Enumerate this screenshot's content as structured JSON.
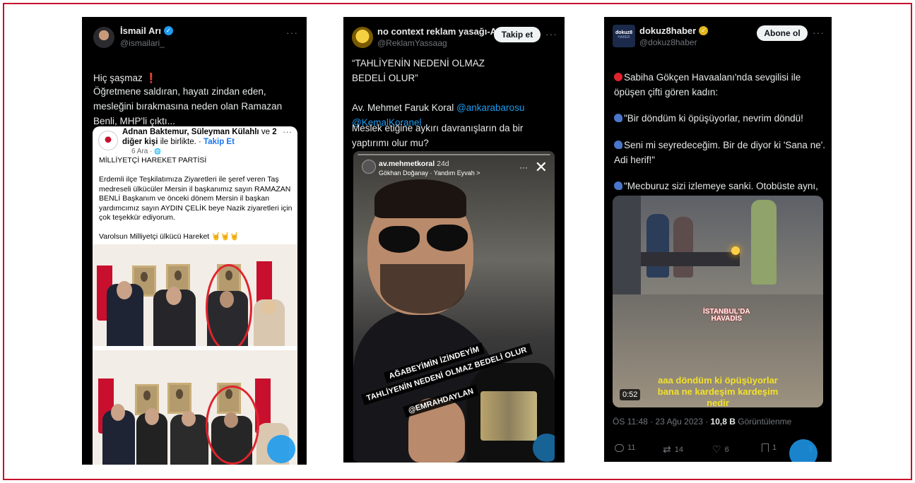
{
  "colors": {
    "border": "#c8102e",
    "card_bg": "#000000",
    "link": "#1d9bf0",
    "gold_badge": "#e2b719",
    "caption_yellow": "#f3e12a"
  },
  "card1": {
    "name": "İsmail Arı",
    "handle": "@ismailari_",
    "more": "···",
    "text_line1": "Hiç şaşmaz ",
    "exclaim": "❗",
    "text_rest": "Öğretmene saldıran, hayatı zindan eden, mesleğini bırakmasına neden olan Ramazan Benli, MHP'li çıktı...",
    "fb": {
      "authors": "Adnan Baktemur, Süleyman Külahlı",
      "and": " ve ",
      "others": "2 diğer kişi",
      "with": " ile birlikte. · ",
      "follow": "Takip Et",
      "date": "6 Ara · ",
      "globe": "🌐",
      "more": "···",
      "body": "MİLLİYETÇİ HAREKET PARTİSİ\n\nErdemli ilçe Teşkilatımıza Ziyaretleri ile şeref veren Taş medreseli ülkücüler Mersin il başkanımız sayın RAMAZAN BENLİ Başkanım ve önceki dönem Mersin il başkan yardımcımız sayın AYDIN ÇELİK beye Nazik ziyaretleri için çok teşekkür ediyorum.\n\nVarolsun Milliyetçi ülkücü Hareket 🤘🤘🤘"
    }
  },
  "card2": {
    "name": "no context reklam yasağı-Av...",
    "handle": "@ReklamYassaag",
    "follow_btn": "Takip et",
    "more": "···",
    "quote": "“TAHLİYENİN NEDENİ OLMAZ\nBEDELİ OLUR”",
    "author": "Av. Mehmet Faruk Koral ",
    "mention1": "@ankarabarosu",
    "mention2": "@KemalKoranel",
    "question": "Meslek etiğine aykırı davranışların da bir yaptırımı olur mu?",
    "story": {
      "user": "av.mehmetkoral",
      "time": " 24d",
      "song": "Gökhan Doğanay · Yandım Eyvah >",
      "dots": "···",
      "close": "✕",
      "cap1": "AĞABEYİMİN İZİNDEYİM",
      "cap2": "TAHLİYENİN NEDENİ OLMAZ BEDELİ OLUR",
      "tag": "@EMRAHDAYLAN"
    }
  },
  "card3": {
    "name": "dokuz8haber",
    "handle": "@dokuz8haber",
    "follow_btn": "Abone ol",
    "more": "···",
    "logo_top": "dokuz8",
    "logo_bottom": "HABER",
    "p1": "Sabiha Gökçen Havaalanı'nda sevgilisi ile öpüşen çifti gören kadın:",
    "p2": "\"Bir döndüm ki öpüşüyorlar, nevrim döndü!",
    "p3": "Seni mi seyredeceğim. Bir de diyor ki 'Sana ne'. Adi herif!\"",
    "p4": "\"Mecburuz sizi izlemeye sanki. Otobüste aynı, durakta aynı. Hadsiz!\"",
    "video_logo": "İSTANBUL'DA\nHAVADİS",
    "caption": "aaa döndüm ki öpüşüyorlar\nbana ne kardeşim kardeşim\nnedir",
    "duration": "0:52",
    "meta_time": "ÖS 11:48 · 23 Ağu 2023 · ",
    "views": "10,8 B",
    "views_label": " Görüntülenme",
    "replies": "11",
    "retweets": "14",
    "likes": "6",
    "bookmarks": "1"
  }
}
